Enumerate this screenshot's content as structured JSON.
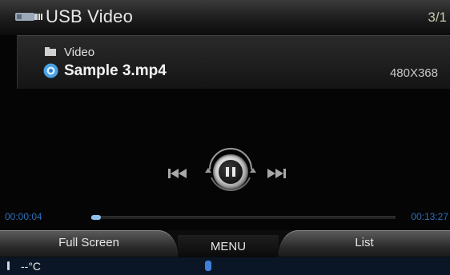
{
  "header": {
    "title": "USB Video",
    "track_counter": "3/1",
    "icon": "usb-video-icon"
  },
  "file_info": {
    "folder": "Video",
    "folder_icon": "folder-icon",
    "file_name": "Sample 3.mp4",
    "file_icon": "video-file-icon",
    "resolution": "480X368"
  },
  "controls": {
    "prev_icon": "previous-track-icon",
    "play_state_icon": "pause-icon",
    "next_icon": "next-track-icon"
  },
  "progress": {
    "elapsed": "00:00:04",
    "total": "00:13:27",
    "fraction": 0.005
  },
  "menu": {
    "left": "Full Screen",
    "center": "MENU",
    "right": "List"
  },
  "status": {
    "temperature": "--°C",
    "temp_icon": "thermometer-icon",
    "bluetooth_icon": "bluetooth-icon"
  },
  "colors": {
    "accent": "#2f6fb8",
    "background": "#050505"
  }
}
